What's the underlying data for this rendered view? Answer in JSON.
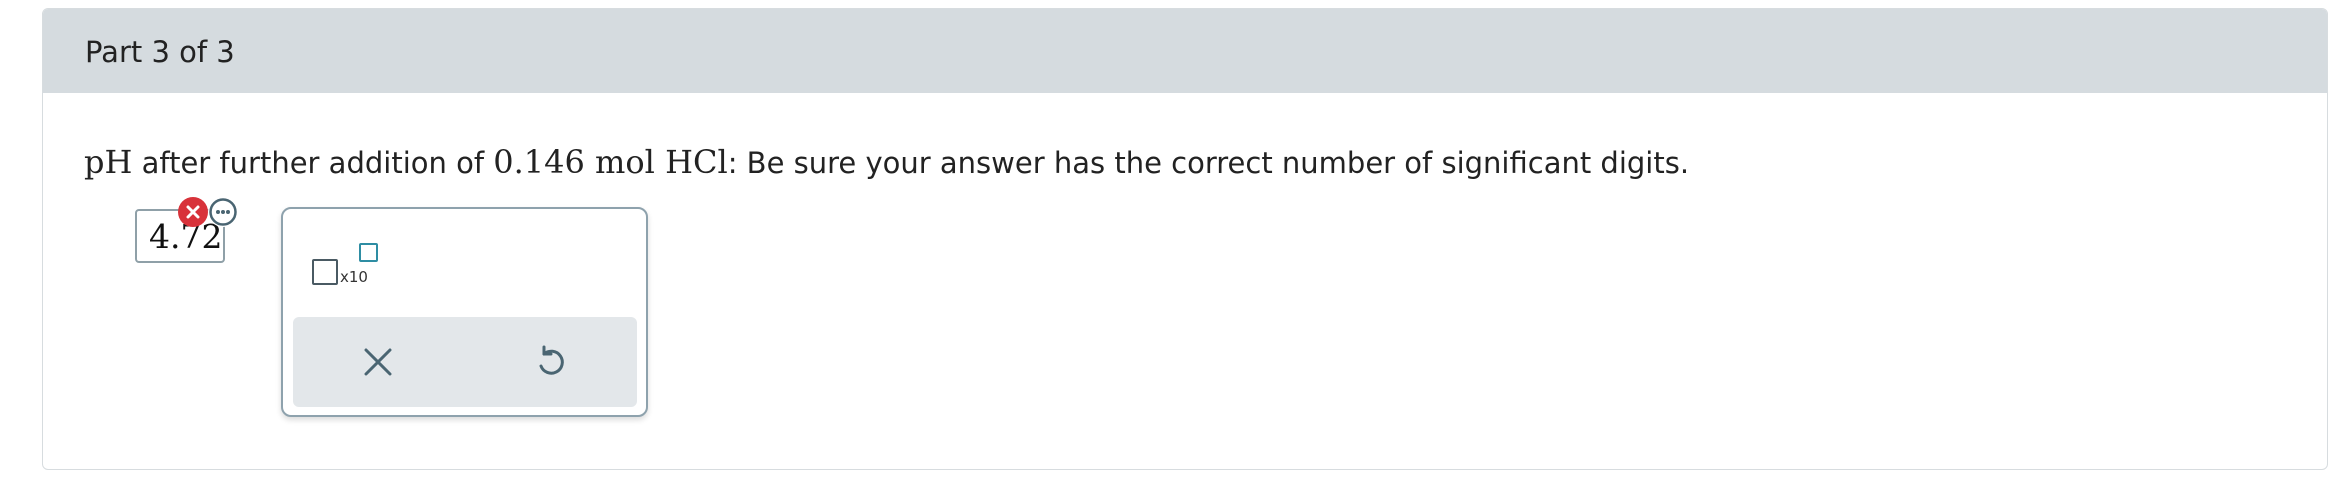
{
  "part": {
    "title": "Part 3 of 3"
  },
  "question": {
    "quantity_symbol": "pH",
    "prefix": " after further addition of ",
    "amount": "0.146",
    "unit": "mol",
    "formula": "HCl",
    "suffix": ": Be sure your answer has the correct number of significant digits."
  },
  "answer": {
    "value": "4.72",
    "error_icon": "x-circle-icon",
    "error_color": "#d8323a",
    "more_icon": "ellipsis-icon"
  },
  "palette": {
    "sci_notation_label": "x10",
    "clear_icon": "close-icon",
    "undo_icon": "undo-icon"
  },
  "colors": {
    "header_bg": "#d5dbdf",
    "accent_teal": "#2e8da3",
    "icon_slate": "#4a6572"
  }
}
